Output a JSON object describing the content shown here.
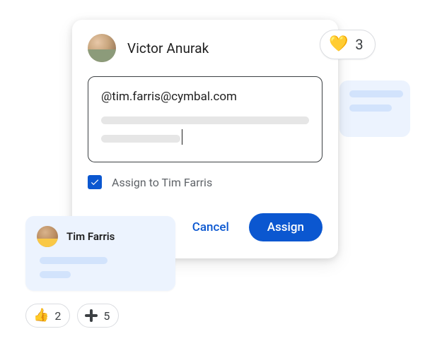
{
  "author": {
    "name": "Victor Anurak"
  },
  "compose": {
    "mention_text": "@tim.farris@cymbal.com"
  },
  "assign": {
    "checked": true,
    "label": "Assign to Tim Farris"
  },
  "actions": {
    "cancel": "Cancel",
    "assign": "Assign"
  },
  "heart_reaction": {
    "emoji": "💛",
    "count": "3"
  },
  "mini_card": {
    "name": "Tim Farris"
  },
  "reactions": {
    "thumbs": {
      "emoji": "👍",
      "count": "2"
    },
    "plus": {
      "count": "5"
    }
  }
}
